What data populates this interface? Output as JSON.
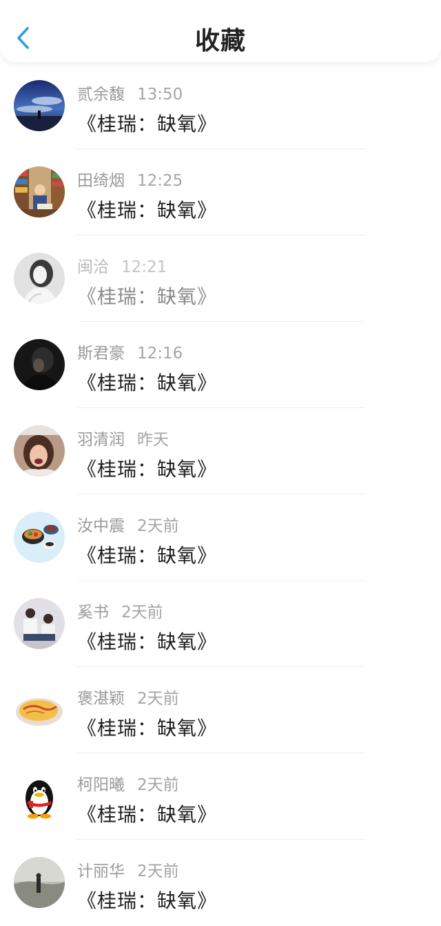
{
  "header": {
    "title": "收藏",
    "back_icon": "chevron-left-icon",
    "accent": "#2f9be8"
  },
  "items": [
    {
      "name": "贰余馥",
      "time": "13:50",
      "title": "《桂瑞：缺氧》",
      "avatar": "sky-silhouette"
    },
    {
      "name": "田绮烟",
      "time": "12:25",
      "title": "《桂瑞：缺氧》",
      "avatar": "child-reading"
    },
    {
      "name": "闽洽",
      "time": "12:21",
      "title": "《桂瑞：缺氧》",
      "avatar": "grayscale-portrait"
    },
    {
      "name": "斯君豪",
      "time": "12:16",
      "title": "《桂瑞：缺氧》",
      "avatar": "dark-profile"
    },
    {
      "name": "羽清润",
      "time": "昨天",
      "title": "《桂瑞：缺氧》",
      "avatar": "laughing-girl"
    },
    {
      "name": "汝中震",
      "time": "2天前",
      "title": "《桂瑞：缺氧》",
      "avatar": "food-bowls"
    },
    {
      "name": "奚书",
      "time": "2天前",
      "title": "《桂瑞：缺氧》",
      "avatar": "couple"
    },
    {
      "name": "褒湛颖",
      "time": "2天前",
      "title": "《桂瑞：缺氧》",
      "avatar": "omelette-plate"
    },
    {
      "name": "柯阳曦",
      "time": "2天前",
      "title": "《桂瑞：缺氧》",
      "avatar": "qq-penguin"
    },
    {
      "name": "计丽华",
      "time": "2天前",
      "title": "《桂瑞：缺氧》",
      "avatar": "misty-landscape"
    }
  ]
}
